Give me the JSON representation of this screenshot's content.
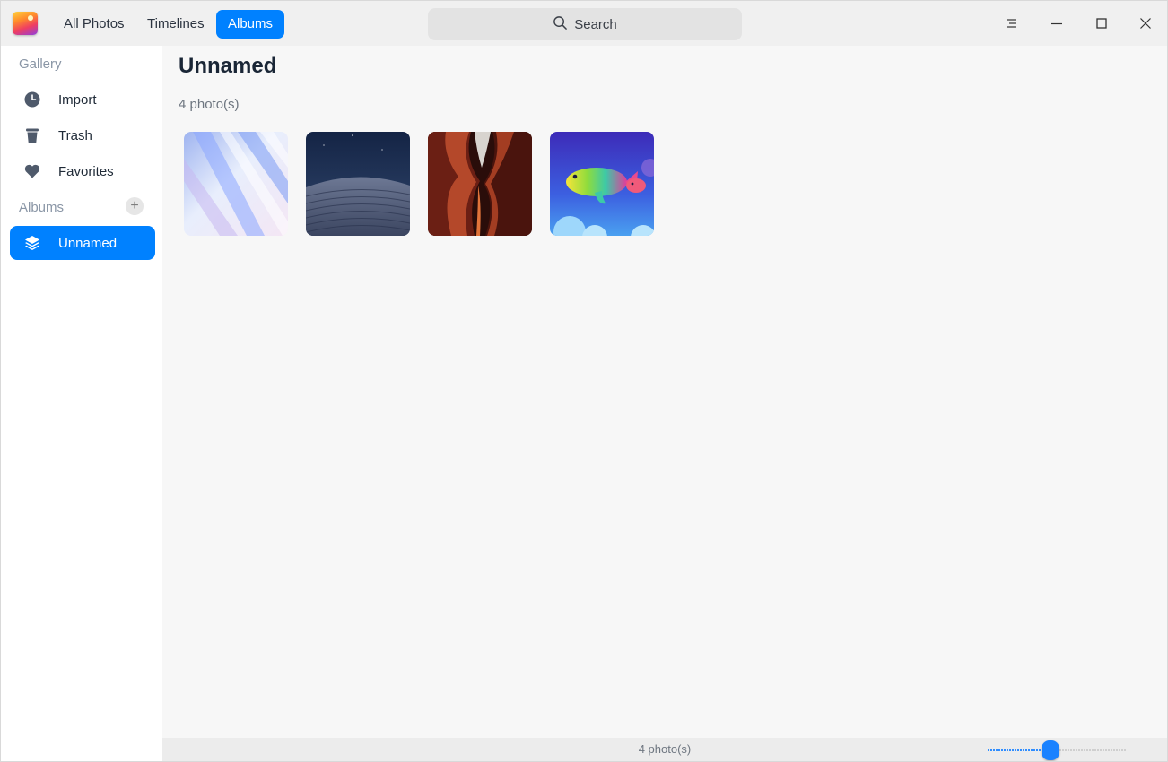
{
  "titlebar": {
    "tabs": [
      {
        "label": "All Photos",
        "active": false
      },
      {
        "label": "Timelines",
        "active": false
      },
      {
        "label": "Albums",
        "active": true
      }
    ],
    "search_placeholder": "Search",
    "window_controls": [
      "menu-icon",
      "minimize-icon",
      "maximize-icon",
      "close-icon"
    ]
  },
  "sidebar": {
    "gallery_heading": "Gallery",
    "gallery_items": [
      {
        "label": "Import",
        "icon": "clock-icon"
      },
      {
        "label": "Trash",
        "icon": "trash-icon"
      },
      {
        "label": "Favorites",
        "icon": "heart-icon"
      }
    ],
    "albums_heading": "Albums",
    "add_album_icon": "plus-icon",
    "album_items": [
      {
        "label": "Unnamed",
        "icon": "layers-icon",
        "active": true
      }
    ]
  },
  "main": {
    "title": "Unnamed",
    "photo_count": "4 photo(s)",
    "photos": [
      {
        "subject": "abstract-blue-light-streaks"
      },
      {
        "subject": "night-desert-dunes"
      },
      {
        "subject": "red-canyon-slot"
      },
      {
        "subject": "rainbow-fish-in-blue-sky"
      }
    ]
  },
  "statusbar": {
    "count": "4 photo(s)",
    "zoom_slider_value": 0.45
  },
  "colors": {
    "accent": "#0081ff",
    "sidebar_bg": "#ffffff",
    "content_bg": "#f7f7f7"
  }
}
